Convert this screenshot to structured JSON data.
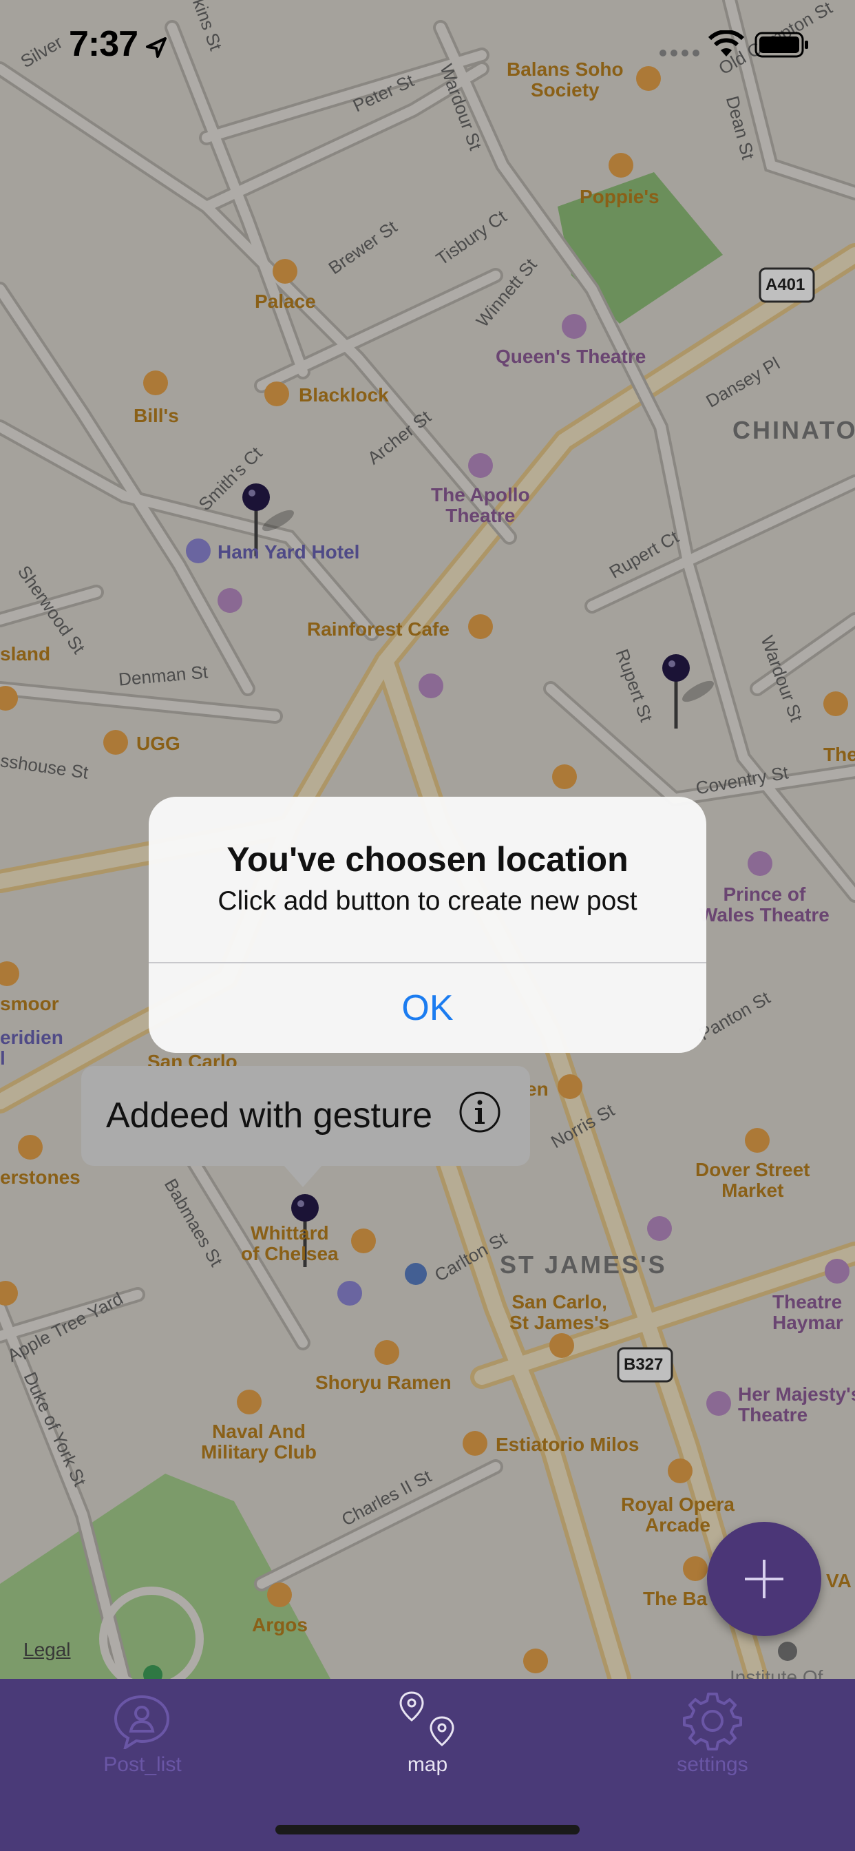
{
  "status_bar": {
    "time": "7:37"
  },
  "map": {
    "legal": "Legal",
    "pois": [
      {
        "name": "Balans Soho\nSociety",
        "color": "#b9801f"
      },
      {
        "name": "Poppie's",
        "color": "#b9801f"
      },
      {
        "name": "Palace",
        "color": "#b9801f"
      },
      {
        "name": "Queen's Theatre",
        "color": "#8e5d98"
      },
      {
        "name": "Bill's",
        "color": "#b9801f"
      },
      {
        "name": "Blacklock",
        "color": "#b9801f"
      },
      {
        "name": "The Apollo\nTheatre",
        "color": "#8e5d98"
      },
      {
        "name": "Ham Yard Hotel",
        "color": "#6a63b5"
      },
      {
        "name": "Rainforest Cafe",
        "color": "#b9801f"
      },
      {
        "name": "UGG",
        "color": "#b9801f"
      },
      {
        "name": "Prince of\nWales Theatre",
        "color": "#8e5d98"
      },
      {
        "name": "Dover Street\nMarket",
        "color": "#b9801f"
      },
      {
        "name": "Whittard\nof Chelsea",
        "color": "#b9801f"
      },
      {
        "name": "San Carlo,\nSt James's",
        "color": "#b9801f"
      },
      {
        "name": "Shoryu Ramen",
        "color": "#b9801f"
      },
      {
        "name": "Naval And\nMilitary Club",
        "color": "#b9801f"
      },
      {
        "name": "Estiatorio Milos",
        "color": "#b9801f"
      },
      {
        "name": "Royal Opera\nArcade",
        "color": "#b9801f"
      },
      {
        "name": "Her Majesty's\nTheatre",
        "color": "#8e5d98"
      },
      {
        "name": "Argos",
        "color": "#b9801f"
      },
      {
        "name": "San Carlo",
        "color": "#b9801f"
      },
      {
        "name": "erstones",
        "color": "#b9801f"
      },
      {
        "name": "smoor",
        "color": "#b9801f"
      },
      {
        "name": "sland",
        "color": "#b9801f"
      },
      {
        "name": "Theatre\nHaymar",
        "color": "#8e5d98"
      },
      {
        "name": "The Ba",
        "color": "#b9801f"
      },
      {
        "name": "The",
        "color": "#b9801f"
      },
      {
        "name": "eridien\nl",
        "color": "#6a63b5"
      },
      {
        "name": "en",
        "color": "#b9801f"
      },
      {
        "name": "VA",
        "color": "#b9801f"
      },
      {
        "name": "Institute Of",
        "color": "#888"
      }
    ],
    "streets": [
      "Silver",
      "kins St",
      "Peter St",
      "Wardour St",
      "Old Compton St",
      "Dean St",
      "Brewer St",
      "Tisbury Ct",
      "Winnett St",
      "Dansey Pl",
      "Smith's Ct",
      "Archer St",
      "Rupert Ct",
      "Sherwood St",
      "Denman St",
      "Rupert St",
      "Wardour St",
      "Coventry St",
      "sshouse St",
      "Panton St",
      "Norris St",
      "Babmaes St",
      "Carlton St",
      "Apple Tree Yard",
      "Duke of York St",
      "Charles II St"
    ],
    "areas": [
      "CHINATO",
      "ST JAMES'S"
    ],
    "road_shields": [
      "A401",
      "B327"
    ]
  },
  "alert": {
    "title": "You've choosen location",
    "message": "Click add button to create new post",
    "ok_label": "OK"
  },
  "callout": {
    "text": "Addeed with gesture"
  },
  "fab": {
    "label": "+"
  },
  "tabbar": {
    "items": [
      {
        "label": "Post_list",
        "icon": "person-bubble-icon"
      },
      {
        "label": "map",
        "icon": "map-pins-icon"
      },
      {
        "label": "settings",
        "icon": "gear-icon"
      }
    ],
    "colors": {
      "active": "#e8e4f2",
      "inactive": "#6a56a6"
    }
  }
}
